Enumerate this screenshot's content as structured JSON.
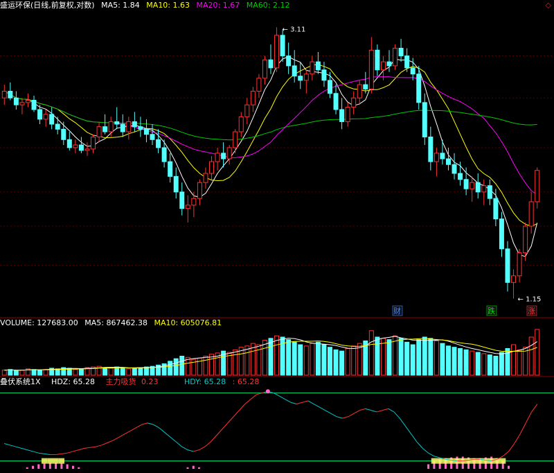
{
  "header": {
    "stock_title": "盛运环保(日线,前复权,对数)",
    "ma5": "MA5: 1.84",
    "ma10": "MA10: 1.63",
    "ma20": "MA20: 1.67",
    "ma60": "MA60: 2.12",
    "corner_icon": "diamond-icon"
  },
  "volume_header": {
    "volume": "VOLUME: 127683.00",
    "ma5": "MA5: 867462.38",
    "ma10": "MA10: 605076.81"
  },
  "indicator_header": {
    "name": "叠伏系统1X",
    "hdz": "HDZ: 65.28",
    "main_label": "主力吸货",
    "main_value": "0.23",
    "hdy": "HDY: 65.28",
    "extra": ": 65.28"
  },
  "colors": {
    "up": "#ff3232",
    "down": "#54ffff",
    "ma5": "#ffffff",
    "ma10": "#ffff00",
    "ma20": "#ff00ff",
    "ma60": "#00c800",
    "grid": "#8b0000",
    "hdy_line": "#00c8c8",
    "ref_line": "#00c864",
    "accumulate": "#ff66cc",
    "base_fill": "#ffff66"
  },
  "chart_data": [
    {
      "type": "candlestick",
      "scale": "log",
      "annotations": [
        {
          "text": "3.11",
          "kind": "high_marker"
        },
        {
          "text": "1.15",
          "kind": "low_marker"
        },
        {
          "text": "财",
          "kind": "event_badge"
        },
        {
          "text": "跌",
          "kind": "event_badge"
        },
        {
          "text": "涨",
          "kind": "event_badge"
        }
      ],
      "ylim": [
        1.1,
        3.3
      ],
      "ohlc": [
        [
          2.4,
          2.52,
          2.34,
          2.46
        ],
        [
          2.46,
          2.54,
          2.38,
          2.4
        ],
        [
          2.4,
          2.46,
          2.3,
          2.34
        ],
        [
          2.34,
          2.4,
          2.26,
          2.36
        ],
        [
          2.36,
          2.44,
          2.32,
          2.38
        ],
        [
          2.38,
          2.42,
          2.28,
          2.3
        ],
        [
          2.3,
          2.34,
          2.18,
          2.22
        ],
        [
          2.22,
          2.3,
          2.16,
          2.26
        ],
        [
          2.26,
          2.32,
          2.14,
          2.18
        ],
        [
          2.18,
          2.24,
          2.1,
          2.14
        ],
        [
          2.14,
          2.2,
          2.02,
          2.06
        ],
        [
          2.06,
          2.12,
          1.98,
          2.0
        ],
        [
          2.0,
          2.06,
          1.96,
          2.02
        ],
        [
          2.02,
          2.08,
          1.96,
          1.98
        ],
        [
          1.98,
          2.04,
          1.94,
          1.99
        ],
        [
          1.99,
          2.1,
          1.96,
          2.08
        ],
        [
          2.08,
          2.2,
          2.04,
          2.16
        ],
        [
          2.16,
          2.26,
          2.1,
          2.12
        ],
        [
          2.12,
          2.24,
          2.08,
          2.2
        ],
        [
          2.2,
          2.32,
          2.14,
          2.18
        ],
        [
          2.18,
          2.26,
          2.08,
          2.12
        ],
        [
          2.12,
          2.24,
          2.06,
          2.2
        ],
        [
          2.2,
          2.28,
          2.12,
          2.16
        ],
        [
          2.16,
          2.24,
          2.08,
          2.14
        ],
        [
          2.14,
          2.22,
          2.04,
          2.1
        ],
        [
          2.1,
          2.18,
          2.02,
          2.06
        ],
        [
          2.06,
          2.14,
          1.96,
          2.0
        ],
        [
          2.0,
          2.06,
          1.86,
          1.9
        ],
        [
          1.9,
          1.96,
          1.76,
          1.8
        ],
        [
          1.8,
          1.86,
          1.66,
          1.7
        ],
        [
          1.7,
          1.76,
          1.56,
          1.6
        ],
        [
          1.6,
          1.68,
          1.52,
          1.62
        ],
        [
          1.62,
          1.7,
          1.55,
          1.66
        ],
        [
          1.66,
          1.78,
          1.62,
          1.76
        ],
        [
          1.76,
          1.86,
          1.72,
          1.82
        ],
        [
          1.82,
          1.94,
          1.78,
          1.9
        ],
        [
          1.9,
          2.0,
          1.84,
          1.96
        ],
        [
          1.96,
          2.04,
          1.86,
          1.92
        ],
        [
          1.92,
          2.02,
          1.88,
          2.0
        ],
        [
          2.0,
          2.14,
          1.96,
          2.12
        ],
        [
          2.12,
          2.28,
          2.08,
          2.24
        ],
        [
          2.24,
          2.4,
          2.18,
          2.34
        ],
        [
          2.34,
          2.5,
          2.28,
          2.46
        ],
        [
          2.46,
          2.62,
          2.4,
          2.58
        ],
        [
          2.58,
          2.8,
          2.52,
          2.76
        ],
        [
          2.76,
          2.92,
          2.62,
          2.68
        ],
        [
          2.68,
          3.11,
          2.64,
          3.02
        ],
        [
          3.02,
          3.08,
          2.74,
          2.8
        ],
        [
          2.8,
          2.94,
          2.62,
          2.7
        ],
        [
          2.7,
          2.86,
          2.54,
          2.6
        ],
        [
          2.6,
          2.74,
          2.48,
          2.56
        ],
        [
          2.56,
          2.66,
          2.44,
          2.62
        ],
        [
          2.62,
          2.8,
          2.56,
          2.74
        ],
        [
          2.74,
          2.84,
          2.62,
          2.66
        ],
        [
          2.66,
          2.74,
          2.5,
          2.56
        ],
        [
          2.56,
          2.64,
          2.4,
          2.44
        ],
        [
          2.44,
          2.52,
          2.26,
          2.3
        ],
        [
          2.3,
          2.4,
          2.14,
          2.2
        ],
        [
          2.2,
          2.36,
          2.16,
          2.32
        ],
        [
          2.32,
          2.46,
          2.26,
          2.4
        ],
        [
          2.4,
          2.56,
          2.34,
          2.52
        ],
        [
          2.52,
          2.64,
          2.44,
          2.48
        ],
        [
          2.48,
          3.0,
          2.44,
          2.86
        ],
        [
          2.86,
          2.92,
          2.6,
          2.66
        ],
        [
          2.66,
          2.8,
          2.56,
          2.74
        ],
        [
          2.74,
          2.86,
          2.64,
          2.7
        ],
        [
          2.7,
          2.92,
          2.66,
          2.88
        ],
        [
          2.88,
          2.98,
          2.74,
          2.8
        ],
        [
          2.8,
          2.88,
          2.64,
          2.68
        ],
        [
          2.68,
          2.78,
          2.56,
          2.62
        ],
        [
          2.62,
          2.7,
          2.3,
          2.36
        ],
        [
          2.36,
          2.44,
          2.02,
          2.08
        ],
        [
          2.08,
          2.16,
          1.84,
          1.9
        ],
        [
          1.9,
          2.0,
          1.8,
          1.96
        ],
        [
          1.96,
          2.06,
          1.88,
          1.92
        ],
        [
          1.92,
          2.0,
          1.84,
          1.88
        ],
        [
          1.88,
          1.96,
          1.78,
          1.82
        ],
        [
          1.82,
          1.9,
          1.74,
          1.78
        ],
        [
          1.78,
          1.86,
          1.68,
          1.72
        ],
        [
          1.72,
          1.8,
          1.64,
          1.76
        ],
        [
          1.76,
          1.82,
          1.66,
          1.7
        ],
        [
          1.7,
          1.78,
          1.62,
          1.74
        ],
        [
          1.74,
          1.78,
          1.62,
          1.66
        ],
        [
          1.66,
          1.72,
          1.5,
          1.54
        ],
        [
          1.54,
          1.58,
          1.34,
          1.38
        ],
        [
          1.38,
          1.42,
          1.18,
          1.22
        ],
        [
          1.22,
          1.28,
          1.15,
          1.25
        ],
        [
          1.25,
          1.38,
          1.22,
          1.36
        ],
        [
          1.36,
          1.52,
          1.32,
          1.5
        ],
        [
          1.5,
          1.7,
          1.46,
          1.64
        ],
        [
          1.64,
          1.86,
          1.6,
          1.84
        ]
      ],
      "ma5_end": 1.84,
      "ma10_end": 1.63,
      "ma20_end": 1.67,
      "ma60_end": 2.12
    },
    {
      "type": "bar",
      "name": "volume",
      "values": [
        8,
        9,
        7,
        8,
        10,
        9,
        8,
        9,
        11,
        10,
        12,
        11,
        9,
        10,
        12,
        13,
        14,
        12,
        11,
        13,
        12,
        10,
        11,
        12,
        13,
        14,
        16,
        18,
        22,
        26,
        30,
        28,
        25,
        27,
        30,
        33,
        35,
        38,
        36,
        40,
        44,
        46,
        50,
        48,
        55,
        58,
        62,
        60,
        56,
        52,
        48,
        46,
        50,
        52,
        48,
        44,
        40,
        38,
        42,
        46,
        50,
        54,
        70,
        60,
        58,
        56,
        62,
        58,
        52,
        48,
        56,
        60,
        58,
        54,
        50,
        46,
        44,
        42,
        40,
        38,
        36,
        34,
        32,
        30,
        36,
        42,
        48,
        40,
        44,
        60,
        72
      ],
      "ma5_end": "867462.38",
      "ma10_end": "605076.81"
    },
    {
      "type": "line",
      "name": "HDY",
      "values": [
        32,
        30,
        28,
        26,
        24,
        22,
        20,
        19,
        18,
        18,
        19,
        20,
        22,
        24,
        26,
        27,
        28,
        30,
        33,
        36,
        40,
        44,
        48,
        52,
        56,
        58,
        56,
        52,
        46,
        40,
        34,
        28,
        24,
        22,
        24,
        28,
        34,
        42,
        50,
        58,
        66,
        74,
        82,
        88,
        94,
        96,
        98,
        96,
        92,
        88,
        84,
        82,
        84,
        86,
        82,
        78,
        74,
        70,
        66,
        64,
        66,
        70,
        74,
        76,
        74,
        72,
        74,
        76,
        72,
        64,
        54,
        44,
        34,
        26,
        20,
        16,
        14,
        12,
        11,
        10,
        10,
        11,
        12,
        12,
        11,
        10,
        12,
        16,
        22,
        32,
        44,
        58,
        72,
        82
      ]
    }
  ]
}
